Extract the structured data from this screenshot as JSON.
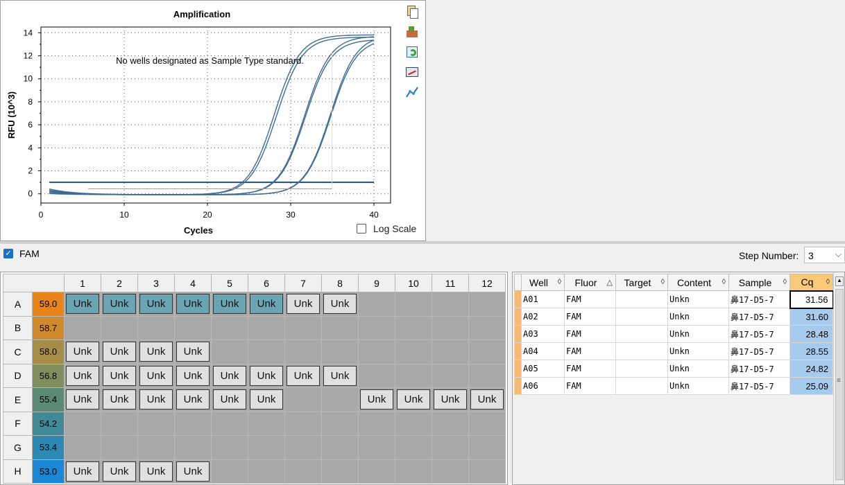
{
  "chart": {
    "title": "Amplification",
    "ylabel": "RFU (10^3)",
    "xlabel": "Cycles",
    "log_scale_label": "Log Scale",
    "log_scale_checked": false
  },
  "chart_data": {
    "type": "line",
    "title": "Amplification",
    "xlabel": "Cycles",
    "ylabel": "RFU (10^3)",
    "xlim": [
      0,
      42
    ],
    "ylim": [
      -0.8,
      14.5
    ],
    "xticks": [
      0,
      10,
      20,
      30,
      40
    ],
    "yticks": [
      0,
      2,
      4,
      6,
      8,
      10,
      12,
      14
    ],
    "grid": true,
    "threshold": 1.0,
    "series": [
      {
        "cq": 31.56,
        "plateau": 13.9,
        "start": 0.2
      },
      {
        "cq": 31.6,
        "plateau": 13.6,
        "start": 0.5
      },
      {
        "cq": 28.48,
        "plateau": 13.8,
        "start": 0.3
      },
      {
        "cq": 28.55,
        "plateau": 13.5,
        "start": 0.1
      },
      {
        "cq": 24.82,
        "plateau": 13.9,
        "start": 0.4
      },
      {
        "cq": 25.09,
        "plateau": 13.7,
        "start": 0.2
      }
    ]
  },
  "chart_tools": [
    "copy-icon",
    "export-icon",
    "refresh-icon",
    "chart-settings-icon",
    "line-style-icon"
  ],
  "std_curve": {
    "message": "No wells designated as Sample Type standard."
  },
  "fluor_toggle": {
    "label": "FAM",
    "checked": true
  },
  "step": {
    "label": "Step Number:",
    "value": "3"
  },
  "plate": {
    "columns": [
      "1",
      "2",
      "3",
      "4",
      "5",
      "6",
      "7",
      "8",
      "9",
      "10",
      "11",
      "12"
    ],
    "rows": [
      {
        "label": "A",
        "temp": "59.0",
        "color": "#e8841a",
        "wells": [
          "sel",
          "sel",
          "sel",
          "sel",
          "sel",
          "sel",
          "unk",
          "unk",
          "",
          "",
          "",
          ""
        ]
      },
      {
        "label": "B",
        "temp": "58.7",
        "color": "#cf8a2d",
        "wells": [
          "",
          "",
          "",
          "",
          "",
          "",
          "",
          "",
          "",
          "",
          "",
          ""
        ]
      },
      {
        "label": "C",
        "temp": "58.0",
        "color": "#a68d45",
        "wells": [
          "unk",
          "unk",
          "unk",
          "unk",
          "",
          "",
          "",
          "",
          "",
          "",
          "",
          ""
        ]
      },
      {
        "label": "D",
        "temp": "56.8",
        "color": "#7f8e5c",
        "wells": [
          "unk",
          "unk",
          "unk",
          "unk",
          "unk",
          "unk",
          "unk",
          "unk",
          "",
          "",
          "",
          ""
        ]
      },
      {
        "label": "E",
        "temp": "55.4",
        "color": "#5b8a73",
        "wells": [
          "unk",
          "unk",
          "unk",
          "unk",
          "unk",
          "unk",
          "",
          "",
          "unk",
          "unk",
          "unk",
          "unk"
        ]
      },
      {
        "label": "F",
        "temp": "54.2",
        "color": "#3f8a96",
        "wells": [
          "",
          "",
          "",
          "",
          "",
          "",
          "",
          "",
          "",
          "",
          "",
          ""
        ]
      },
      {
        "label": "G",
        "temp": "53.4",
        "color": "#2e88b4",
        "wells": [
          "",
          "",
          "",
          "",
          "",
          "",
          "",
          "",
          "",
          "",
          "",
          ""
        ]
      },
      {
        "label": "H",
        "temp": "53.0",
        "color": "#1a86d6",
        "wells": [
          "unk",
          "unk",
          "unk",
          "unk",
          "",
          "",
          "",
          "",
          "",
          "",
          "",
          ""
        ]
      }
    ],
    "unk_label": "Unk"
  },
  "results": {
    "headers": [
      "Well",
      "Fluor",
      "Target",
      "Content",
      "Sample",
      "Cq"
    ],
    "rows": [
      {
        "well": "A01",
        "fluor": "FAM",
        "target": "",
        "content": "Unkn",
        "sample": "鼻17-D5-7",
        "cq": "31.56"
      },
      {
        "well": "A02",
        "fluor": "FAM",
        "target": "",
        "content": "Unkn",
        "sample": "鼻17-D5-7",
        "cq": "31.60"
      },
      {
        "well": "A03",
        "fluor": "FAM",
        "target": "",
        "content": "Unkn",
        "sample": "鼻17-D5-7",
        "cq": "28.48"
      },
      {
        "well": "A04",
        "fluor": "FAM",
        "target": "",
        "content": "Unkn",
        "sample": "鼻17-D5-7",
        "cq": "28.55"
      },
      {
        "well": "A05",
        "fluor": "FAM",
        "target": "",
        "content": "Unkn",
        "sample": "鼻17-D5-7",
        "cq": "24.82"
      },
      {
        "well": "A06",
        "fluor": "FAM",
        "target": "",
        "content": "Unkn",
        "sample": "鼻17-D5-7",
        "cq": "25.09"
      }
    ]
  }
}
